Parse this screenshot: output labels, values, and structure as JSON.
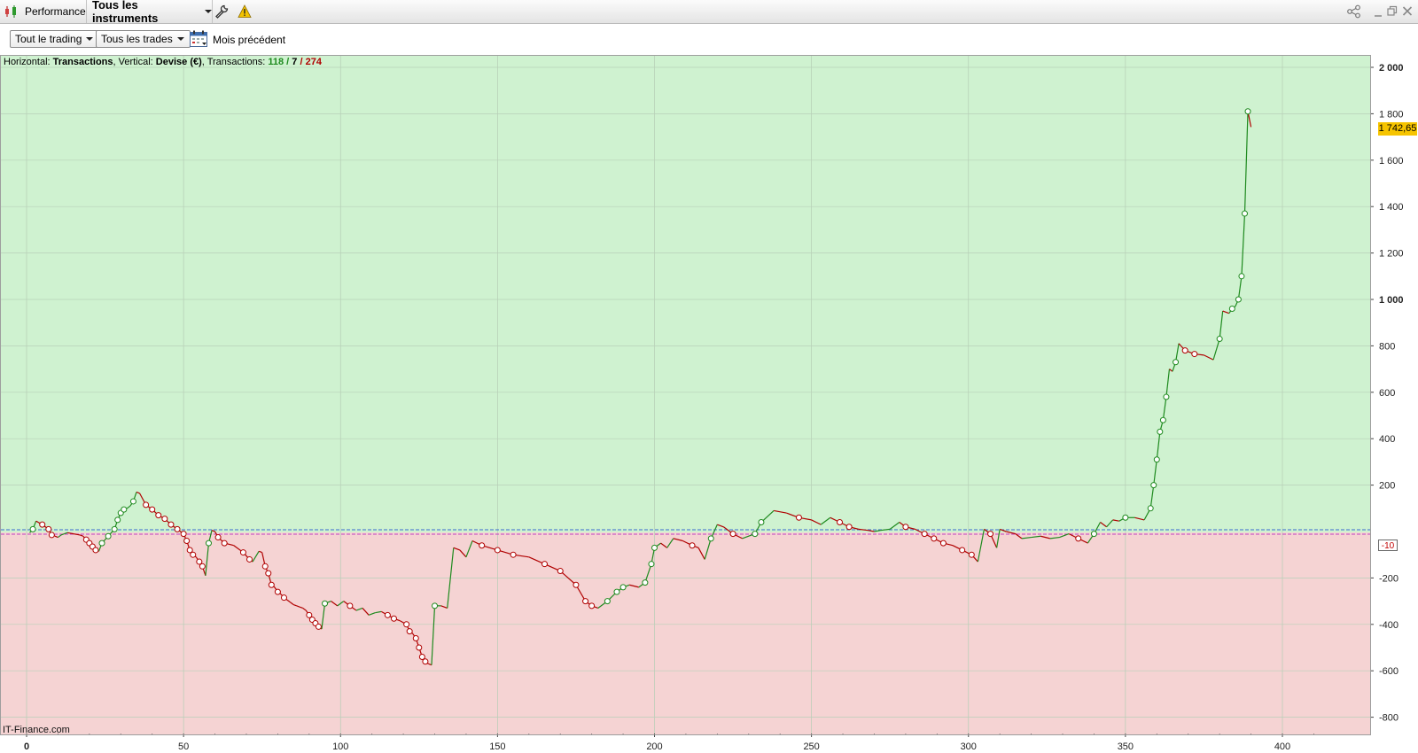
{
  "titlebar": {
    "section_label": "Performance",
    "instrument_selector": "Tous les instruments",
    "tool_icons": [
      "wrench-icon",
      "warning-icon"
    ],
    "window_icons": [
      "share-icon",
      "minimize-icon",
      "restore-icon",
      "close-icon"
    ]
  },
  "filters": {
    "trading_scope": "Tout le trading",
    "trade_filter": "Tous les trades",
    "period": "Mois précédent"
  },
  "info_line": {
    "prefix_horizontal": "Horizontal: ",
    "horizontal_value": "Transactions",
    "prefix_vertical": ", Vertical: ",
    "vertical_value": "Devise (€)",
    "prefix_transactions": ", Transactions: ",
    "tx_winning": "118",
    "sep1": " / ",
    "tx_neutral": "7",
    "sep2": " / ",
    "tx_losing": "274"
  },
  "watermark": "IT-Finance.com",
  "current_value_label": "1 742,65",
  "zero_line_label": "-10",
  "colors": {
    "positive_zone": "#cff2d0",
    "negative_zone": "#f5d3d3",
    "gain_line": "#1e8a1e",
    "loss_line": "#b00000",
    "price_tag": "#f6c400"
  },
  "chart_data": {
    "type": "line",
    "xlabel": "",
    "ylabel": "",
    "xlim": [
      0,
      420
    ],
    "ylim": [
      -800,
      2000
    ],
    "x_ticks": [
      "0",
      "50",
      "100",
      "150",
      "200",
      "250",
      "300",
      "350",
      "400"
    ],
    "y_ticks": [
      "2 000",
      "1 800",
      "1 600",
      "1 400",
      "1 200",
      "1 000",
      "800",
      "600",
      "400",
      "200",
      "-200",
      "-400",
      "-600",
      "-800"
    ],
    "grid": true,
    "series": [
      {
        "points": [
          [
            1,
            -5
          ],
          [
            2,
            10
          ],
          [
            3,
            45
          ],
          [
            5,
            30
          ],
          [
            7,
            10
          ],
          [
            8,
            -15
          ],
          [
            9,
            -20
          ],
          [
            10,
            -25
          ],
          [
            11,
            -15
          ],
          [
            12,
            -10
          ],
          [
            13,
            -5
          ],
          [
            15,
            -10
          ],
          [
            17,
            -15
          ],
          [
            18,
            -20
          ],
          [
            19,
            -35
          ],
          [
            20,
            -50
          ],
          [
            21,
            -65
          ],
          [
            22,
            -80
          ],
          [
            23,
            -85
          ],
          [
            24,
            -50
          ],
          [
            26,
            -20
          ],
          [
            28,
            10
          ],
          [
            29,
            50
          ],
          [
            30,
            80
          ],
          [
            31,
            95
          ],
          [
            32,
            100
          ],
          [
            33,
            110
          ],
          [
            34,
            130
          ],
          [
            35,
            170
          ],
          [
            36,
            165
          ],
          [
            38,
            115
          ],
          [
            40,
            95
          ],
          [
            42,
            70
          ],
          [
            44,
            55
          ],
          [
            46,
            30
          ],
          [
            48,
            10
          ],
          [
            50,
            -10
          ],
          [
            51,
            -40
          ],
          [
            52,
            -80
          ],
          [
            53,
            -100
          ],
          [
            54,
            -110
          ],
          [
            55,
            -130
          ],
          [
            56,
            -150
          ],
          [
            57,
            -190
          ],
          [
            58,
            -50
          ],
          [
            59,
            5
          ],
          [
            60,
            0
          ],
          [
            61,
            -25
          ],
          [
            63,
            -50
          ],
          [
            66,
            -60
          ],
          [
            69,
            -90
          ],
          [
            71,
            -120
          ],
          [
            72,
            -130
          ],
          [
            74,
            -85
          ],
          [
            75,
            -90
          ],
          [
            76,
            -150
          ],
          [
            77,
            -180
          ],
          [
            78,
            -230
          ],
          [
            79,
            -240
          ],
          [
            80,
            -260
          ],
          [
            81,
            -270
          ],
          [
            82,
            -285
          ],
          [
            83,
            -295
          ],
          [
            84,
            -305
          ],
          [
            85,
            -315
          ],
          [
            86,
            -320
          ],
          [
            87,
            -325
          ],
          [
            88,
            -330
          ],
          [
            89,
            -340
          ],
          [
            90,
            -360
          ],
          [
            91,
            -380
          ],
          [
            92,
            -395
          ],
          [
            93,
            -410
          ],
          [
            94,
            -420
          ],
          [
            95,
            -310
          ],
          [
            97,
            -300
          ],
          [
            99,
            -320
          ],
          [
            101,
            -300
          ],
          [
            103,
            -320
          ],
          [
            105,
            -340
          ],
          [
            107,
            -330
          ],
          [
            109,
            -360
          ],
          [
            111,
            -350
          ],
          [
            113,
            -345
          ],
          [
            115,
            -360
          ],
          [
            117,
            -375
          ],
          [
            119,
            -385
          ],
          [
            121,
            -400
          ],
          [
            122,
            -430
          ],
          [
            123,
            -440
          ],
          [
            124,
            -460
          ],
          [
            125,
            -500
          ],
          [
            126,
            -540
          ],
          [
            127,
            -560
          ],
          [
            128,
            -570
          ],
          [
            129,
            -575
          ],
          [
            130,
            -320
          ],
          [
            132,
            -320
          ],
          [
            134,
            -330
          ],
          [
            136,
            -70
          ],
          [
            138,
            -80
          ],
          [
            140,
            -110
          ],
          [
            142,
            -40
          ],
          [
            145,
            -60
          ],
          [
            150,
            -80
          ],
          [
            155,
            -100
          ],
          [
            160,
            -110
          ],
          [
            165,
            -140
          ],
          [
            170,
            -170
          ],
          [
            175,
            -230
          ],
          [
            178,
            -300
          ],
          [
            180,
            -320
          ],
          [
            182,
            -330
          ],
          [
            185,
            -300
          ],
          [
            188,
            -260
          ],
          [
            190,
            -240
          ],
          [
            192,
            -230
          ],
          [
            195,
            -240
          ],
          [
            197,
            -220
          ],
          [
            199,
            -140
          ],
          [
            200,
            -70
          ],
          [
            202,
            -50
          ],
          [
            204,
            -70
          ],
          [
            206,
            -30
          ],
          [
            209,
            -40
          ],
          [
            212,
            -60
          ],
          [
            214,
            -70
          ],
          [
            216,
            -120
          ],
          [
            218,
            -30
          ],
          [
            220,
            30
          ],
          [
            222,
            20
          ],
          [
            225,
            -10
          ],
          [
            228,
            -30
          ],
          [
            232,
            -10
          ],
          [
            234,
            40
          ],
          [
            238,
            90
          ],
          [
            242,
            80
          ],
          [
            246,
            60
          ],
          [
            250,
            50
          ],
          [
            253,
            30
          ],
          [
            256,
            60
          ],
          [
            259,
            40
          ],
          [
            262,
            20
          ],
          [
            265,
            10
          ],
          [
            268,
            5
          ],
          [
            270,
            0
          ],
          [
            272,
            5
          ],
          [
            275,
            10
          ],
          [
            278,
            40
          ],
          [
            280,
            20
          ],
          [
            283,
            10
          ],
          [
            286,
            -10
          ],
          [
            289,
            -30
          ],
          [
            292,
            -50
          ],
          [
            295,
            -60
          ],
          [
            298,
            -80
          ],
          [
            301,
            -100
          ],
          [
            303,
            -130
          ],
          [
            305,
            10
          ],
          [
            307,
            -10
          ],
          [
            309,
            -70
          ],
          [
            310,
            10
          ],
          [
            312,
            0
          ],
          [
            315,
            -10
          ],
          [
            317,
            -30
          ],
          [
            320,
            -25
          ],
          [
            323,
            -20
          ],
          [
            326,
            -30
          ],
          [
            329,
            -25
          ],
          [
            332,
            -10
          ],
          [
            335,
            -30
          ],
          [
            338,
            -50
          ],
          [
            340,
            -10
          ],
          [
            342,
            40
          ],
          [
            344,
            20
          ],
          [
            346,
            50
          ],
          [
            348,
            45
          ],
          [
            350,
            60
          ],
          [
            353,
            60
          ],
          [
            356,
            50
          ],
          [
            358,
            100
          ],
          [
            359,
            200
          ],
          [
            360,
            310
          ],
          [
            361,
            430
          ],
          [
            362,
            480
          ],
          [
            363,
            580
          ],
          [
            364,
            700
          ],
          [
            365,
            690
          ],
          [
            366,
            730
          ],
          [
            367,
            810
          ],
          [
            369,
            780
          ],
          [
            372,
            765
          ],
          [
            375,
            760
          ],
          [
            378,
            740
          ],
          [
            380,
            830
          ],
          [
            381,
            950
          ],
          [
            383,
            940
          ],
          [
            384,
            960
          ],
          [
            385,
            970
          ],
          [
            386,
            1000
          ],
          [
            387,
            1100
          ],
          [
            388,
            1370
          ],
          [
            389,
            1810
          ],
          [
            390,
            1743
          ]
        ]
      }
    ]
  }
}
